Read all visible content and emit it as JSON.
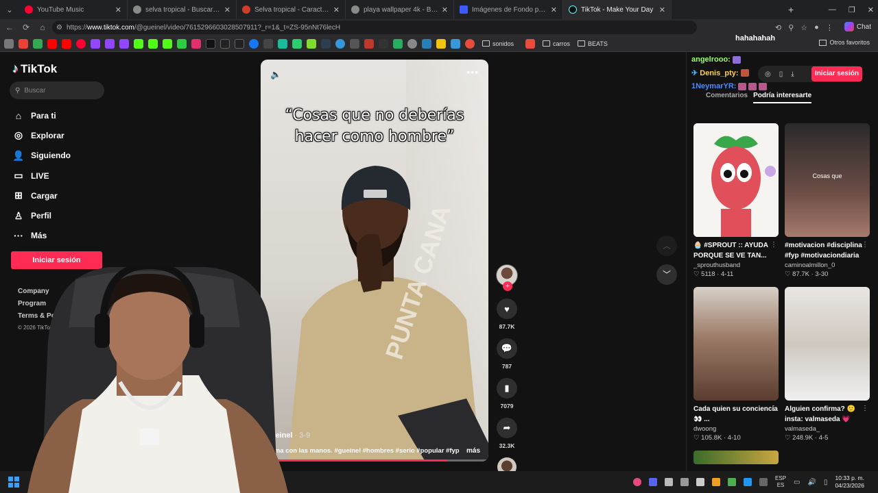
{
  "browser": {
    "tabs": [
      {
        "title": "YouTube Music",
        "color": "#ff0033"
      },
      {
        "title": "selva tropical - Buscar con Google",
        "color": "#8a8a8a"
      },
      {
        "title": "Selva tropical - Características, clim",
        "color": "#d23c2a"
      },
      {
        "title": "playa wallpaper 4k - Buscar con G",
        "color": "#8a8a8a"
      },
      {
        "title": "Imágenes de Fondo pantalla play",
        "color": "#3d5afe"
      },
      {
        "title": "TikTok - Make Your Day",
        "color": "#111111"
      }
    ],
    "url_prefix": "https://",
    "url_host": "www.tiktok.com",
    "url_path": "/@gueinel/video/7615296603028507911?_r=1&_t=ZS-95nNt76lecH",
    "chat_label": "Chat",
    "bookmark_folders": [
      "sonidos",
      "carros",
      "BEATS"
    ],
    "other_favorites": "Otros favoritos"
  },
  "tiktok": {
    "logo": "TikTok",
    "search_placeholder": "Buscar",
    "nav": [
      {
        "label": "Para ti",
        "icon": "home-icon"
      },
      {
        "label": "Explorar",
        "icon": "compass-icon"
      },
      {
        "label": "Siguiendo",
        "icon": "following-icon"
      },
      {
        "label": "LIVE",
        "icon": "live-icon"
      },
      {
        "label": "Cargar",
        "icon": "upload-icon"
      },
      {
        "label": "Perfil",
        "icon": "profile-icon"
      },
      {
        "label": "Más",
        "icon": "more-icon"
      }
    ],
    "login": "Iniciar sesión",
    "footer": [
      "Company",
      "Program",
      "Terms & Policies"
    ],
    "copyright": "© 2026 TikTok"
  },
  "video": {
    "overlay_title_line1": "“Cosas que no deberías",
    "overlay_title_line2": "hacer como hombre”",
    "author": "gueinel",
    "date": " · 3-9",
    "description": "oma con las manos. #gueinel #hombres #serio #popular #fyp",
    "more": "más",
    "progress": 0.82,
    "likes": "87.7K",
    "comments": "787",
    "saves": "7079",
    "shares": "32.3K"
  },
  "right_panel": {
    "login": "Iniciar sesión",
    "tabs": [
      "Comentarios",
      "Podría interesarte"
    ],
    "cards": [
      {
        "title": "🧁 #SPROUT :: AYUDA PORQUE SE VE TAN...",
        "user": "_sprouthusband",
        "stats": "♡ 5118 · 4-11",
        "thumb_text": ""
      },
      {
        "title": "#motivacion #disciplina #fyp #motivaciondiaria",
        "user": "caminoalmillon_0",
        "stats": "♡ 87.7K · 3-30",
        "thumb_text": "Cosas que"
      },
      {
        "title": "Cada quien su conciencia 👀 ...",
        "user": "dwoong",
        "stats": "♡ 105.8K · 4-10",
        "thumb_text": ""
      },
      {
        "title": "Alguien confirma? 🙂 insta: valmaseda 💗",
        "user": "valmaseda_",
        "stats": "♡ 248.9K · 4-5",
        "thumb_text": ""
      }
    ]
  },
  "stream_chat": [
    {
      "user": "angelrooo:",
      "text": "",
      "color": "#9cff6b"
    },
    {
      "user": "Denis_pty:",
      "text": "",
      "color": "#ffd24a"
    },
    {
      "user": "1NeymarYR:",
      "text": "",
      "color": "#4a8cff"
    },
    {
      "user": "",
      "text": "hahahahah",
      "color": "#ffffff"
    }
  ],
  "taskbar": {
    "lang_line1": "ESP",
    "lang_line2": "ES",
    "time": "10:33 p. m.",
    "date": "04/23/2026"
  }
}
